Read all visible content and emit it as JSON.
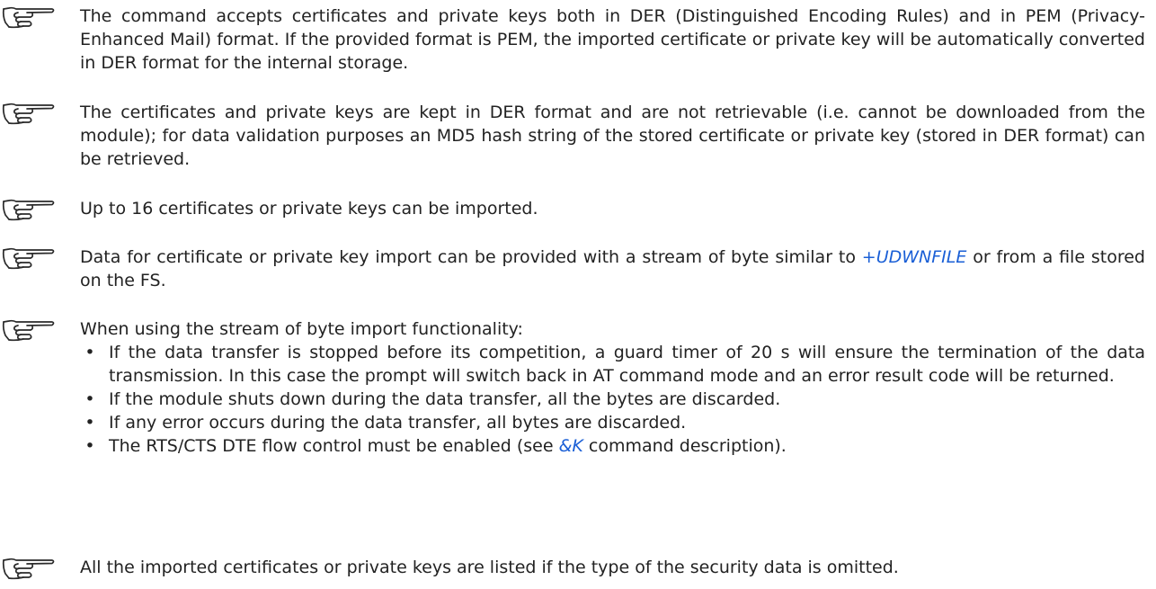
{
  "icons": {
    "note": "pointing-hand-icon"
  },
  "colors": {
    "link": "#1a5fd6",
    "text": "#222222"
  },
  "notes": [
    {
      "text": "The command accepts certificates and private keys both in DER (Distinguished Encoding Rules) and in PEM (Privacy-Enhanced Mail) format. If the provided format is PEM, the imported certificate or private key will be automatically converted in DER format for the internal storage."
    },
    {
      "text": "The certificates and private keys are kept in DER format and are not retrievable (i.e. cannot be downloaded from the module); for data validation purposes an MD5 hash string of the stored certificate or private key (stored in DER format) can be retrieved."
    },
    {
      "text": "Up to 16 certificates or private keys can be imported."
    },
    {
      "text_before": "Data for certificate or private key import can be provided with a stream of byte similar to ",
      "link": "+UDWNFILE",
      "text_after": " or from a file stored on the FS."
    },
    {
      "text": "When using the stream of byte import functionality:",
      "bullets": [
        "If the data transfer is stopped before its competition, a guard timer of 20 s will ensure the termination of the data transmission. In this case the prompt will switch back in AT command mode and an error result code will be returned.",
        "If the module shuts down during the data transfer, all the bytes are discarded.",
        "If any error occurs during the data transfer, all bytes are discarded."
      ],
      "last_bullet": {
        "before": "The RTS/CTS DTE flow control must be enabled (see ",
        "link": "&K",
        "after": " command description)."
      }
    },
    {
      "text": "All the imported certificates or private keys are listed if the type of the security data is omitted."
    }
  ],
  "bullet_glyph": "•"
}
